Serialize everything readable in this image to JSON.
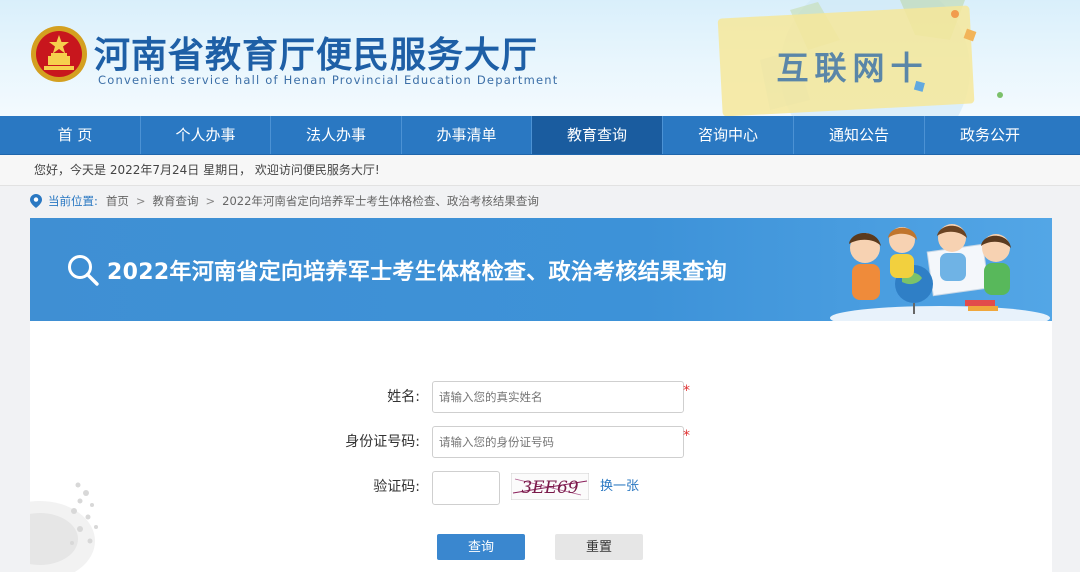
{
  "header": {
    "title": "河南省教育厅便民服务大厅",
    "subtitle": "Convenient service hall of Henan Provincial Education Department",
    "decoration_text": "互联网十"
  },
  "nav": {
    "items": [
      {
        "label": "首 页"
      },
      {
        "label": "个人办事"
      },
      {
        "label": "法人办事"
      },
      {
        "label": "办事清单"
      },
      {
        "label": "教育查询"
      },
      {
        "label": "咨询中心"
      },
      {
        "label": "通知公告"
      },
      {
        "label": "政务公开"
      }
    ],
    "active_index": 4
  },
  "welcome": {
    "text": "您好，今天是 2022年7月24日 星期日，  欢迎访问便民服务大厅!"
  },
  "breadcrumb": {
    "label": "当前位置:",
    "items": [
      "首页",
      "教育查询",
      "2022年河南省定向培养军士考生体格检查、政治考核结果查询"
    ],
    "separator": ">"
  },
  "banner": {
    "title": "2022年河南省定向培养军士考生体格检查、政治考核结果查询"
  },
  "form": {
    "name": {
      "label": "姓名:",
      "placeholder": "请输入您的真实姓名",
      "required_mark": "*"
    },
    "id_number": {
      "label": "身份证号码:",
      "placeholder": "请输入您的身份证号码",
      "required_mark": "*"
    },
    "captcha": {
      "label": "验证码:",
      "code": "3EE69",
      "refresh_label": "换一张"
    },
    "query_button": "查询",
    "reset_button": "重置"
  },
  "colors": {
    "nav": "#2a78c2",
    "nav_active": "#1a5c9f",
    "banner": "#3f8fd3",
    "title_blue": "#1e5fa6",
    "required": "#e03030"
  }
}
